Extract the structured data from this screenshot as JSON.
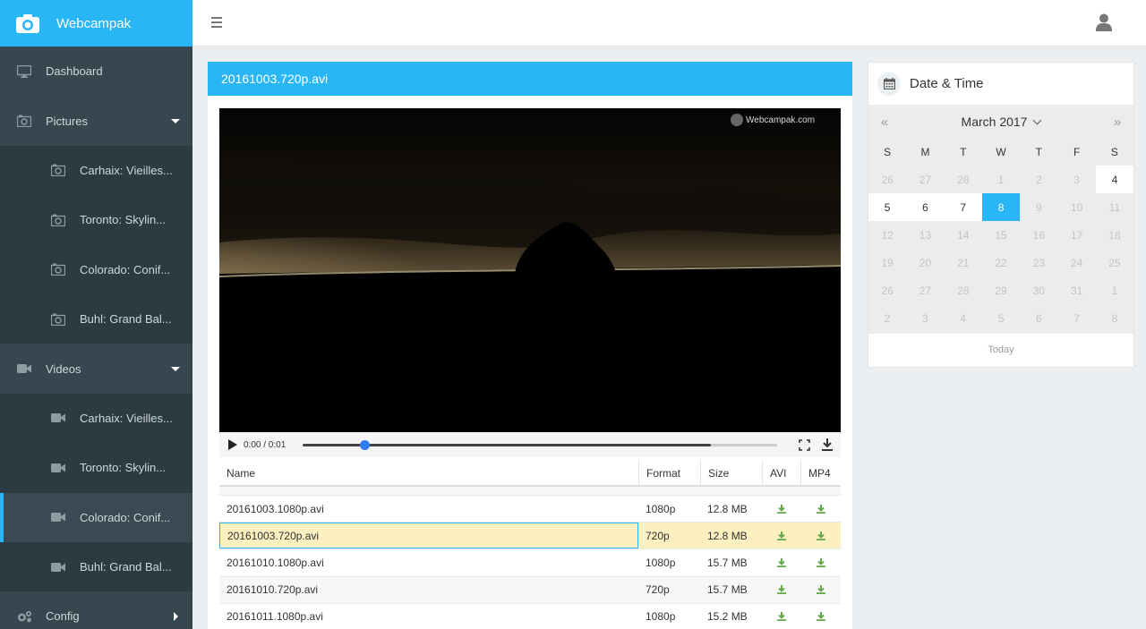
{
  "app": {
    "title": "Webcampak"
  },
  "sidebar": {
    "items": [
      {
        "label": "Dashboard",
        "icon": "monitor-icon",
        "type": "top"
      },
      {
        "label": "Pictures",
        "icon": "camera-icon",
        "type": "top",
        "caret": "down"
      },
      {
        "label": "Carhaix: Vieilles...",
        "icon": "camera-icon",
        "type": "sub"
      },
      {
        "label": "Toronto: Skylin...",
        "icon": "camera-icon",
        "type": "sub"
      },
      {
        "label": "Colorado: Conif...",
        "icon": "camera-icon",
        "type": "sub"
      },
      {
        "label": "Buhl: Grand Bal...",
        "icon": "camera-icon",
        "type": "sub"
      },
      {
        "label": "Videos",
        "icon": "video-icon",
        "type": "top",
        "caret": "down"
      },
      {
        "label": "Carhaix: Vieilles...",
        "icon": "video-icon",
        "type": "sub"
      },
      {
        "label": "Toronto: Skylin...",
        "icon": "video-icon",
        "type": "sub"
      },
      {
        "label": "Colorado: Conif...",
        "icon": "video-icon",
        "type": "sub",
        "active": true
      },
      {
        "label": "Buhl: Grand Bal...",
        "icon": "video-icon",
        "type": "sub"
      },
      {
        "label": "Config",
        "icon": "gears-icon",
        "type": "top",
        "caret": "right"
      }
    ]
  },
  "video": {
    "title": "20161003.720p.avi",
    "watermark": "Webcampak.com",
    "time": "0:00 / 0:01",
    "progress": 0.13,
    "buffered": 0.86
  },
  "table": {
    "headers": {
      "name": "Name",
      "format": "Format",
      "size": "Size",
      "avi": "AVI",
      "mp4": "MP4"
    },
    "rows": [
      {
        "name": "20161003.1080p.avi",
        "format": "1080p",
        "size": "12.8 MB"
      },
      {
        "name": "20161003.720p.avi",
        "format": "720p",
        "size": "12.8 MB",
        "selected": true
      },
      {
        "name": "20161010.1080p.avi",
        "format": "1080p",
        "size": "15.7 MB"
      },
      {
        "name": "20161010.720p.avi",
        "format": "720p",
        "size": "15.7 MB"
      },
      {
        "name": "20161011.1080p.avi",
        "format": "1080p",
        "size": "15.2 MB"
      }
    ]
  },
  "datetime": {
    "title": "Date & Time",
    "month": "March 2017",
    "prev": "«",
    "next": "»",
    "dow": [
      "S",
      "M",
      "T",
      "W",
      "T",
      "F",
      "S"
    ],
    "days": [
      [
        "26",
        "27",
        "28",
        "1",
        "2",
        "3",
        "4"
      ],
      [
        "5",
        "6",
        "7",
        "8",
        "9",
        "10",
        "11"
      ],
      [
        "12",
        "13",
        "14",
        "15",
        "16",
        "17",
        "18"
      ],
      [
        "19",
        "20",
        "21",
        "22",
        "23",
        "24",
        "25"
      ],
      [
        "26",
        "27",
        "28",
        "29",
        "30",
        "31",
        "1"
      ],
      [
        "2",
        "3",
        "4",
        "5",
        "6",
        "7",
        "8"
      ]
    ],
    "enabled": [
      "4",
      "5",
      "6",
      "7"
    ],
    "selected": "8",
    "today_label": "Today"
  },
  "colors": {
    "accent": "#29b6f6",
    "sidebar": "#263238",
    "download": "#6aa84f",
    "selected_row": "#fcefc0"
  }
}
